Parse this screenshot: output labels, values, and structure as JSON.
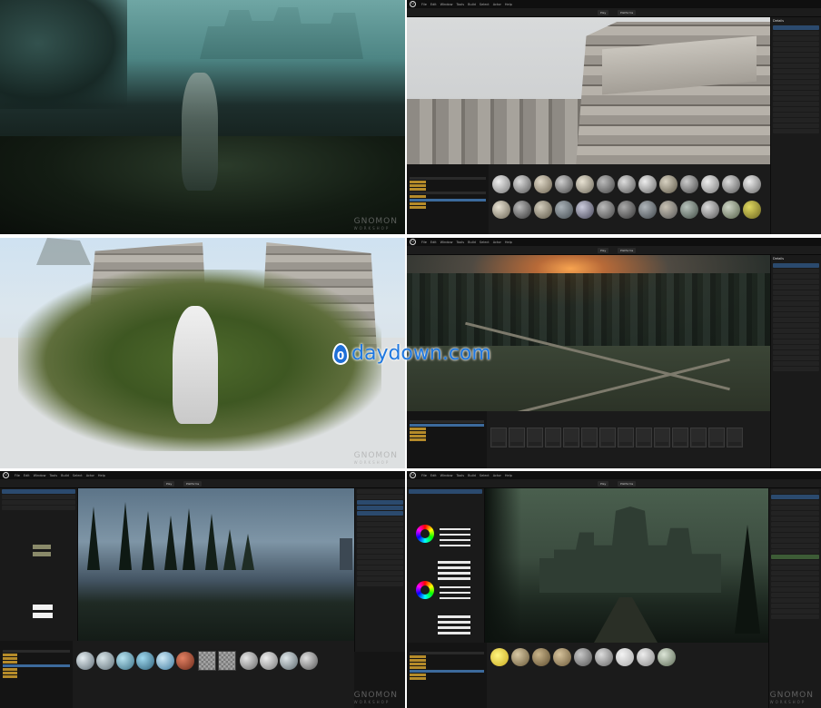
{
  "watermark": {
    "brand": "GNOMON",
    "sub": "WORKSHOP",
    "site": "daydown.com",
    "site_icon_glyph": "0"
  },
  "editor": {
    "logo_glyph": "U",
    "menu_items": [
      "File",
      "Edit",
      "Window",
      "Tools",
      "Build",
      "Select",
      "Actor",
      "Help"
    ],
    "play_label": "Play",
    "platforms_label": "Platforms",
    "details_label": "Details"
  },
  "colors": {
    "ui_bg": "#151515",
    "panel_bg": "#1a1a1a",
    "selection": "#2b4a6e",
    "folder": "#b58b2a",
    "watermark_blue": "#1f78e0"
  }
}
